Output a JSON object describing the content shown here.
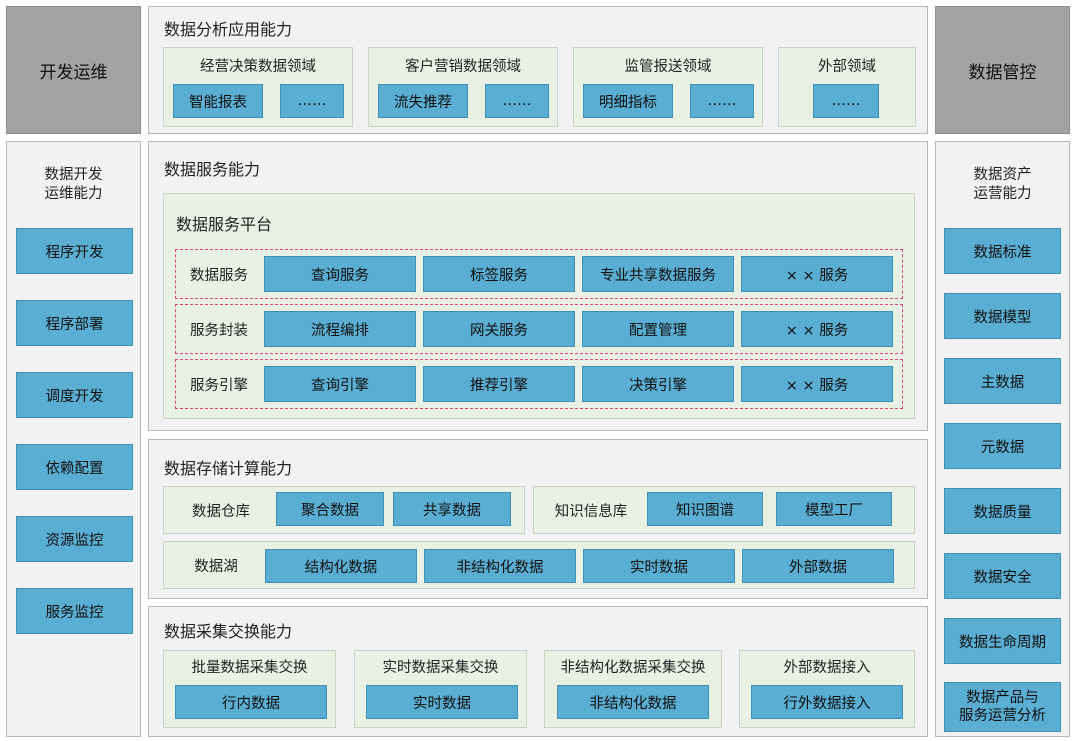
{
  "dev_ops": {
    "header": "开发运维",
    "title_line1": "数据开发",
    "title_line2": "运维能力",
    "items": [
      "程序开发",
      "程序部署",
      "调度开发",
      "依赖配置",
      "资源监控",
      "服务监控"
    ]
  },
  "governance": {
    "header": "数据管控",
    "title_line1": "数据资产",
    "title_line2": "运营能力",
    "items": [
      "数据标准",
      "数据模型",
      "主数据",
      "元数据",
      "数据质量",
      "数据安全",
      "数据生命周期"
    ],
    "last_line1": "数据产品与",
    "last_line2": "服务运营分析"
  },
  "analysis": {
    "title": "数据分析应用能力",
    "domains": [
      {
        "title": "经营决策数据领域",
        "items": [
          "智能报表",
          "……"
        ]
      },
      {
        "title": "客户营销数据领域",
        "items": [
          "流失推荐",
          "……"
        ]
      },
      {
        "title": "监管报送领域",
        "items": [
          "明细指标",
          "……"
        ]
      },
      {
        "title": "外部领域",
        "items": [
          "……"
        ]
      }
    ]
  },
  "service": {
    "title": "数据服务能力",
    "platform_title": "数据服务平台",
    "rows": [
      {
        "label": "数据服务",
        "items": [
          "查询服务",
          "标签服务",
          "专业共享数据服务",
          "× × 服务"
        ]
      },
      {
        "label": "服务封装",
        "items": [
          "流程编排",
          "网关服务",
          "配置管理",
          "× × 服务"
        ]
      },
      {
        "label": "服务引擎",
        "items": [
          "查询引擎",
          "推荐引擎",
          "决策引擎",
          "× × 服务"
        ]
      }
    ]
  },
  "storage": {
    "title": "数据存储计算能力",
    "warehouse": {
      "label": "数据仓库",
      "items": [
        "聚合数据",
        "共享数据"
      ]
    },
    "knowledge": {
      "label": "知识信息库",
      "items": [
        "知识图谱",
        "模型工厂"
      ]
    },
    "lake": {
      "label": "数据湖",
      "items": [
        "结构化数据",
        "非结构化数据",
        "实时数据",
        "外部数据"
      ]
    }
  },
  "collection": {
    "title": "数据采集交换能力",
    "groups": [
      {
        "title": "批量数据采集交换",
        "item": "行内数据"
      },
      {
        "title": "实时数据采集交换",
        "item": "实时数据"
      },
      {
        "title": "非结构化数据采集交换",
        "item": "非结构化数据"
      },
      {
        "title": "外部数据接入",
        "item": "行外数据接入"
      }
    ]
  }
}
